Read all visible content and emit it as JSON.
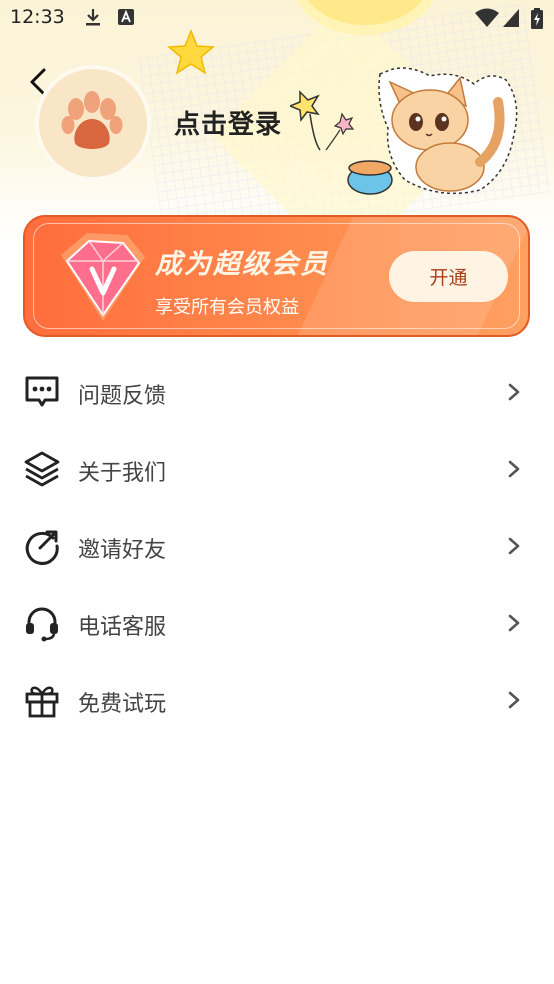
{
  "status_bar": {
    "time": "12:33",
    "left_icons": [
      "download-icon",
      "app-notification-icon"
    ],
    "right_icons": [
      "wifi-icon",
      "signal-icon",
      "battery-charging-icon"
    ]
  },
  "header": {
    "login_text": "点击登录",
    "avatar_icon": "paw-icon"
  },
  "vip": {
    "title": "成为超级会员",
    "subtitle": "享受所有会员权益",
    "button_label": "开通",
    "gradient_start": "#ff6d3d",
    "gradient_end": "#ffa061",
    "icon": "diamond-v-icon"
  },
  "menu": [
    {
      "label": "问题反馈",
      "icon": "feedback-icon"
    },
    {
      "label": "关于我们",
      "icon": "layers-icon"
    },
    {
      "label": "邀请好友",
      "icon": "share-arrow-icon"
    },
    {
      "label": "电话客服",
      "icon": "headset-icon"
    },
    {
      "label": "免费试玩",
      "icon": "gift-icon"
    }
  ]
}
